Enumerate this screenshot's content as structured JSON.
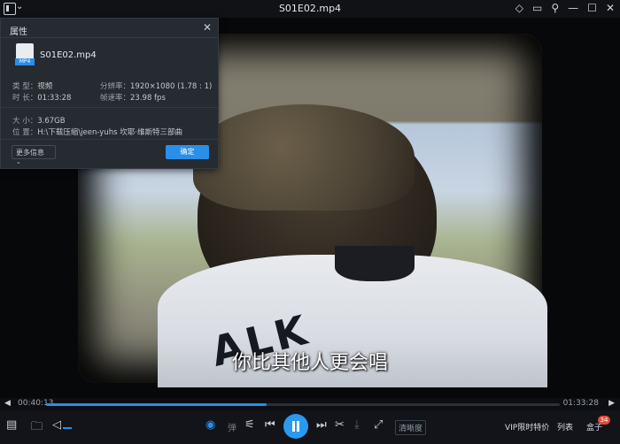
{
  "window": {
    "title": "S01E02.mp4"
  },
  "properties_dialog": {
    "title": "属性",
    "file_name": "S01E02.mp4",
    "file_type_tag": "MP4",
    "type_label": "类  型：",
    "type_value": "视频",
    "resolution_label": "分辨率：",
    "resolution_value": "1920×1080 (1.78 : 1)",
    "duration_label": "时  长：",
    "duration_value": "01:33:28",
    "framerate_label": "帧速率：",
    "framerate_value": "23.98 fps",
    "size_label": "大  小：",
    "size_value": "3.67GB",
    "location_label": "位  置：",
    "location_value": "H:\\下载压缩\\jeen-yuhs 坎耶·维斯特三部曲",
    "more_info_button": "更多信息",
    "ok_button": "确定"
  },
  "video": {
    "subtitle": "你比其他人更会唱",
    "jersey_text": "ALK"
  },
  "playback": {
    "current_time": "00:40:13",
    "total_time": "01:33:28",
    "progress_fraction": 0.43
  },
  "controls": {
    "danmaku_label": "弹",
    "clarity_label": "清晰度",
    "vip_label": "VIP限时特价",
    "list_label": "列表",
    "box_label": "盒子",
    "box_badge": "34"
  },
  "colors": {
    "accent": "#2a8fe8",
    "badge": "#e24a3b"
  }
}
